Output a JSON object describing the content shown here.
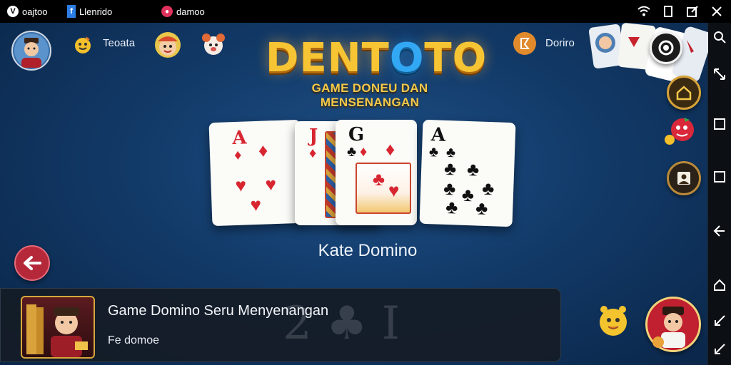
{
  "statusbar": {
    "app1": "oajtoo",
    "app1_logo": "V",
    "app2": "Llenrido",
    "app3": "damoo",
    "icons": [
      "wifi-icon",
      "square-icon",
      "edit-icon",
      "close-icon"
    ]
  },
  "header": {
    "player_label": "Teoata",
    "right_label": "Doriro"
  },
  "logo": {
    "title_a": "DENT",
    "title_o": "O",
    "title_b": "TO",
    "title_o2": "O",
    "subtitle": "GAME DONEU DAN MENSENANGAN"
  },
  "cards": [
    {
      "rank": "A",
      "suit": "♦",
      "color": "red"
    },
    {
      "rank": "J",
      "suit": "♦",
      "color": "red"
    },
    {
      "rank": "G",
      "suit": "♣",
      "color": "black"
    },
    {
      "rank": "A",
      "suit": "♣",
      "color": "black"
    }
  ],
  "game": {
    "name": "Kate Domino"
  },
  "banner": {
    "title": "Game Domino Seru Menyenangan",
    "subtitle": "Fe domoe"
  },
  "colors": {
    "background": "#123a68",
    "logo_gold": "#f7c534",
    "logo_blue": "#32a8f5",
    "back_button": "#b5283a"
  }
}
